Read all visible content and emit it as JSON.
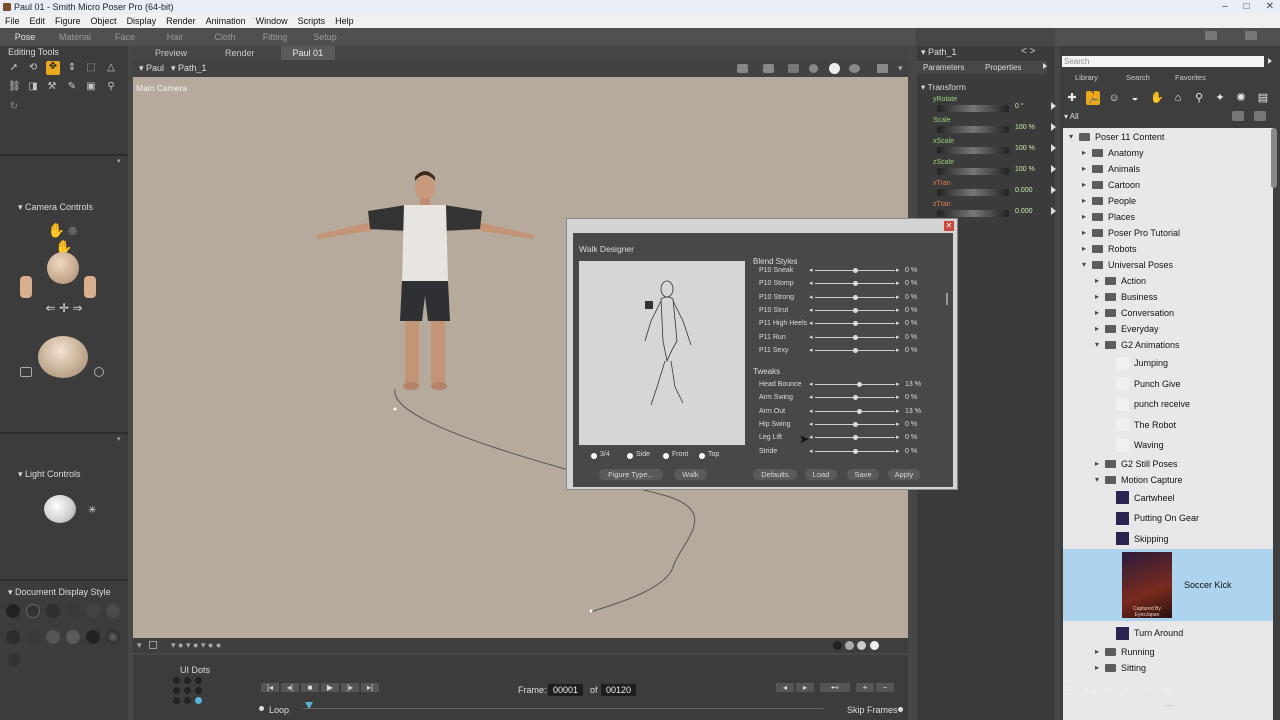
{
  "window": {
    "title": "Paul 01 - Smith Micro Poser Pro  (64-bit)",
    "min": "–",
    "max": "□",
    "close": "✕"
  },
  "menu": [
    "File",
    "Edit",
    "Figure",
    "Object",
    "Display",
    "Render",
    "Animation",
    "Window",
    "Scripts",
    "Help"
  ],
  "rooms": [
    {
      "label": "Pose",
      "active": true
    },
    {
      "label": "Material"
    },
    {
      "label": "Face"
    },
    {
      "label": "Hair"
    },
    {
      "label": "Cloth"
    },
    {
      "label": "Fitting"
    },
    {
      "label": "Setup"
    }
  ],
  "left": {
    "editing_tools": "Editing Tools",
    "camera_controls": "Camera Controls",
    "light_controls": "Light Controls",
    "doc_display_style": "Document Display Style"
  },
  "viewport": {
    "tabs": [
      {
        "label": "Preview"
      },
      {
        "label": "Render"
      },
      {
        "label": "Paul 01",
        "active": true
      }
    ],
    "figure_select": "Paul",
    "actor_select": "Path_1",
    "camera_label": "Main Camera"
  },
  "animation": {
    "ui_dots": "UI Dots",
    "frame_label": "Frame:",
    "frame_value": "00001",
    "of_label": "of",
    "total_frames": "00120",
    "loop_label": "Loop",
    "skip_frames_label": "Skip Frames"
  },
  "params": {
    "actor": "Path_1",
    "tabs": [
      "Parameters",
      "Properties"
    ],
    "group": "Transform",
    "rows": [
      {
        "name": "yRotate",
        "value": "0 °"
      },
      {
        "name": "Scale",
        "value": "100 %"
      },
      {
        "name": "xScale",
        "value": "100 %"
      },
      {
        "name": "zScale",
        "value": "100 %"
      },
      {
        "name": "xTran",
        "value": "0.000"
      },
      {
        "name": "zTran",
        "value": "0.000"
      }
    ]
  },
  "walk_designer": {
    "title": "Walk Designer",
    "blend_styles_label": "Blend Styles",
    "blend_styles": [
      {
        "name": "P10 Sneak",
        "value": "0 %",
        "level": 0.5
      },
      {
        "name": "P10 Stomp",
        "value": "0 %",
        "level": 0.5
      },
      {
        "name": "P10 Strong",
        "value": "0 %",
        "level": 0.5
      },
      {
        "name": "P10 Strut",
        "value": "0 %",
        "level": 0.5
      },
      {
        "name": "P11 High Heels",
        "value": "0 %",
        "level": 0.5
      },
      {
        "name": "P11 Run",
        "value": "0 %",
        "level": 0.5
      },
      {
        "name": "P11 Sexy",
        "value": "0 %",
        "level": 0.5
      }
    ],
    "tweaks_label": "Tweaks",
    "tweaks": [
      {
        "name": "Head Bounce",
        "value": "13 %",
        "level": 0.55
      },
      {
        "name": "Arm Swing",
        "value": "0 %",
        "level": 0.5
      },
      {
        "name": "Arm Out",
        "value": "13 %",
        "level": 0.55
      },
      {
        "name": "Hip Swing",
        "value": "0 %",
        "level": 0.5
      },
      {
        "name": "Leg Lift",
        "value": "0 %",
        "level": 0.5
      },
      {
        "name": "Stride",
        "value": "0 %",
        "level": 0.5
      }
    ],
    "views": [
      "3/4",
      "Side",
      "Front",
      "Top"
    ],
    "buttons": {
      "figure_type": "Figure Type...",
      "walk": "Walk",
      "defaults": "Defaults",
      "load": "Load",
      "save": "Save",
      "apply": "Apply"
    }
  },
  "library": {
    "search_placeholder": "Search",
    "tabs": [
      "Library",
      "Search",
      "Favorites"
    ],
    "filter": "All",
    "tree": [
      {
        "label": "Poser 11 Content",
        "depth": 0,
        "open": true
      },
      {
        "label": "Anatomy",
        "depth": 1
      },
      {
        "label": "Animals",
        "depth": 1
      },
      {
        "label": "Cartoon",
        "depth": 1
      },
      {
        "label": "People",
        "depth": 1
      },
      {
        "label": "Places",
        "depth": 1
      },
      {
        "label": "Poser Pro Tutorial",
        "depth": 1
      },
      {
        "label": "Robots",
        "depth": 1
      },
      {
        "label": "Universal Poses",
        "depth": 1,
        "open": true
      },
      {
        "label": "Action",
        "depth": 2
      },
      {
        "label": "Business",
        "depth": 2
      },
      {
        "label": "Conversation",
        "depth": 2
      },
      {
        "label": "Everyday",
        "depth": 2
      },
      {
        "label": "G2 Animations",
        "depth": 2,
        "open": true
      }
    ],
    "g2_items": [
      "Jumping",
      "Punch Give",
      "punch receive",
      "The Robot",
      "Waving"
    ],
    "still_poses": "G2 Still Poses",
    "motion_capture": "Motion Capture",
    "mocap_items": [
      "Cartwheel",
      "Putting On Gear",
      "Skipping"
    ],
    "selected_item": "Soccer Kick",
    "thumb_caption": "Captured By EyesJapan",
    "after_items": [
      "Turn Around"
    ],
    "more_folders": [
      "Running",
      "Sitting"
    ]
  },
  "colors": {
    "selected": "#aed3ee",
    "param_green": "#99d07a"
  }
}
